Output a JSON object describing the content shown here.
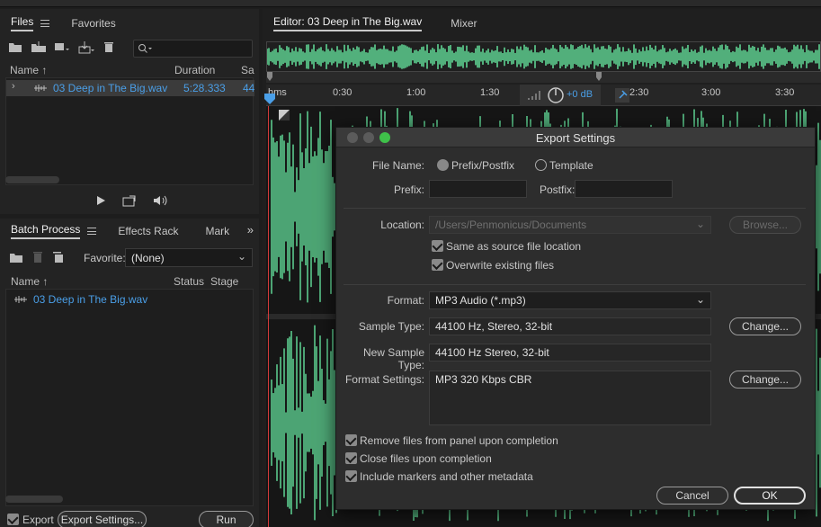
{
  "files_panel": {
    "tab_files": "Files",
    "tab_favorites": "Favorites",
    "col_name": "Name",
    "col_duration": "Duration",
    "col_sample": "Sa",
    "file_name": "03 Deep in The Big.wav",
    "file_duration": "5:28.333",
    "file_sample": "44"
  },
  "batch_panel": {
    "tab_batch": "Batch Process",
    "tab_effects": "Effects Rack",
    "tab_markers": "Mark",
    "favorite_label": "Favorite:",
    "favorite_value": "(None)",
    "col_name": "Name",
    "col_status": "Status",
    "col_stage": "Stage",
    "file_name": "03 Deep in The Big.wav",
    "export_label": "Export",
    "export_settings_btn": "Export Settings...",
    "run_btn": "Run"
  },
  "editor": {
    "tab_editor": "Editor: 03 Deep in The Big.wav",
    "tab_mixer": "Mixer",
    "ruler_labels": [
      "hms",
      "0:30",
      "1:00",
      "1:30",
      "2:30",
      "3:00",
      "3:30"
    ],
    "volume": "+0 dB"
  },
  "dialog": {
    "title": "Export Settings",
    "file_name_label": "File Name:",
    "radio_prefix": "Prefix/Postfix",
    "radio_template": "Template",
    "prefix_label": "Prefix:",
    "postfix_label": "Postfix:",
    "location_label": "Location:",
    "location_value": "/Users/Penmonicus/Documents",
    "browse_btn": "Browse...",
    "same_as_source": "Same as source file location",
    "overwrite": "Overwrite existing files",
    "format_label": "Format:",
    "format_value": "MP3 Audio (*.mp3)",
    "sample_type_label": "Sample Type:",
    "sample_type_value": "44100 Hz, Stereo, 32-bit",
    "change_btn": "Change...",
    "new_sample_type_label": "New Sample Type:",
    "new_sample_type_value": "44100 Hz Stereo, 32-bit",
    "format_settings_label": "Format Settings:",
    "format_settings_value": "MP3 320 Kbps CBR",
    "change_btn2": "Change...",
    "remove_files": "Remove files from panel upon completion",
    "close_files": "Close files upon completion",
    "include_markers": "Include markers and other metadata",
    "cancel_btn": "Cancel",
    "ok_btn": "OK"
  },
  "colors": {
    "waveform": "#5fd493",
    "link": "#4a9fe8",
    "playhead": "#d23a3a"
  }
}
